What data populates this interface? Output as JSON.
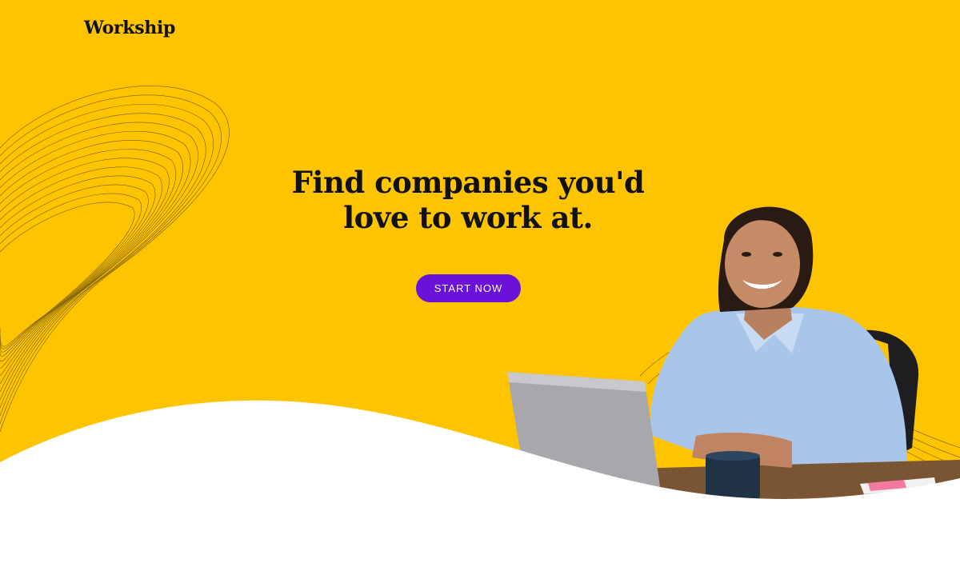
{
  "brand": {
    "name": "Workship"
  },
  "hero": {
    "headline_line1": "Find companies you'd",
    "headline_line2": "love to work at.",
    "cta_label": "START NOW"
  },
  "colors": {
    "hero_background": "#ffc400",
    "cta_background": "#6a12d8",
    "wave": "#ffffff"
  },
  "image": {
    "semantic": "smiling woman in blue shirt at desk with laptop"
  }
}
